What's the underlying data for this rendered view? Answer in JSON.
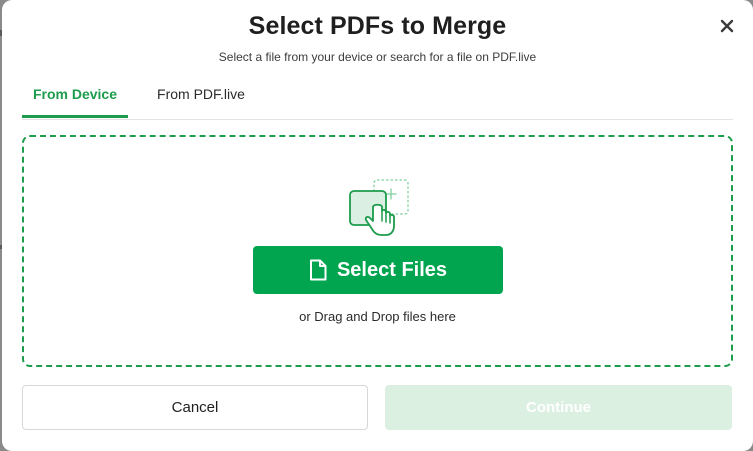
{
  "dialog": {
    "title": "Select PDFs to Merge",
    "subtitle": "Select a file from your device or search for a file on PDF.live",
    "close_icon": "close-icon"
  },
  "tabs": [
    {
      "label": "From Device",
      "active": true
    },
    {
      "label": "From PDF.live",
      "active": false
    }
  ],
  "dropzone": {
    "illustration_icon": "hand-pointer-upload-icon",
    "select_button_label": "Select Files",
    "select_button_icon": "file-icon",
    "drag_text": "or Drag and Drop files here"
  },
  "footer": {
    "cancel_label": "Cancel",
    "continue_label": "Continue",
    "continue_enabled": false
  },
  "colors": {
    "accent": "#02a54f",
    "accent_dark": "#1c9c4c",
    "continue_disabled_bg": "#dcf0e2"
  }
}
